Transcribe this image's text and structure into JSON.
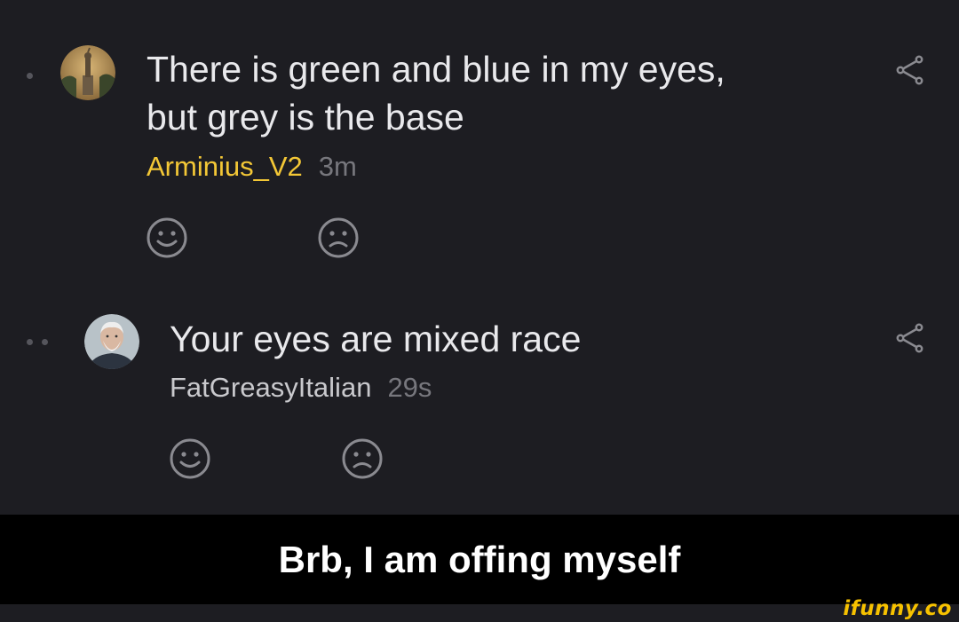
{
  "comments": [
    {
      "text": "There is green and blue in my eyes,\nbut grey is the base",
      "username": "Arminius_V2",
      "time": "3m",
      "username_color": "#f3c736",
      "avatar_icon": "statue-avatar-icon",
      "thread_depth": 1
    },
    {
      "text": "Your eyes are mixed race",
      "username": "FatGreasyItalian",
      "time": "29s",
      "username_color": "#c9c9cd",
      "avatar_icon": "old-man-avatar-icon",
      "thread_depth": 2
    }
  ],
  "reactions": {
    "smile_icon": "smile-icon",
    "frown_icon": "frown-icon"
  },
  "share_icon": "share-icon",
  "caption": "Brb, I am offing myself",
  "watermark": "ifunny.co",
  "colors": {
    "background": "#1d1d22",
    "text": "#e9e9ec",
    "accent_username": "#f3c736",
    "timestamp": "#77777d",
    "icon": "#8a8a90",
    "caption_bar": "#000000",
    "watermark": "#f7c200"
  }
}
